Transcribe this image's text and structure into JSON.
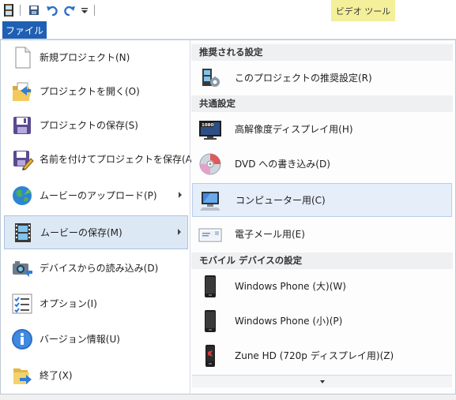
{
  "titlebar": {
    "context_tab": "ビデオ ツール",
    "icons": [
      "app-icon",
      "save-icon",
      "undo-icon",
      "redo-icon",
      "customize-dropdown-icon"
    ]
  },
  "ribbon": {
    "file_tab": "ファイル"
  },
  "file_menu": {
    "items": [
      {
        "label": "新規プロジェクト(N)",
        "icon": "new-document-icon"
      },
      {
        "label": "プロジェクトを開く(O)",
        "icon": "open-folder-icon"
      },
      {
        "label": "プロジェクトの保存(S)",
        "icon": "floppy-save-icon"
      },
      {
        "label": "名前を付けてプロジェクトを保存(A)",
        "icon": "save-as-icon"
      },
      {
        "label": "ムービーのアップロード(P)",
        "icon": "globe-upload-icon",
        "submenu": true
      },
      {
        "label": "ムービーの保存(M)",
        "icon": "film-save-icon",
        "submenu": true,
        "active": true
      },
      {
        "label": "デバイスからの読み込み(D)",
        "icon": "camera-import-icon"
      },
      {
        "label": "オプション(I)",
        "icon": "options-list-icon"
      },
      {
        "label": "バージョン情報(U)",
        "icon": "info-icon"
      },
      {
        "label": "終了(X)",
        "icon": "exit-icon"
      }
    ]
  },
  "save_movie_submenu": {
    "sections": [
      {
        "header": "推奨される設定",
        "items": [
          {
            "label": "このプロジェクトの推奨設定(R)",
            "icon": "recommended-settings-icon"
          }
        ]
      },
      {
        "header": "共通設定",
        "items": [
          {
            "label": "高解像度ディスプレイ用(H)",
            "icon": "hd-display-icon",
            "badge": "1080"
          },
          {
            "label": "DVD への書き込み(D)",
            "icon": "dvd-icon"
          },
          {
            "label": "コンピューター用(C)",
            "icon": "computer-icon",
            "hover": true
          },
          {
            "label": "電子メール用(E)",
            "icon": "email-icon"
          }
        ]
      },
      {
        "header": "モバイル デバイスの設定",
        "items": [
          {
            "label": "Windows Phone (大)(W)",
            "icon": "windows-phone-large-icon"
          },
          {
            "label": "Windows Phone (小)(P)",
            "icon": "windows-phone-small-icon"
          },
          {
            "label": "Zune HD (720p ディスプレイ用)(Z)",
            "icon": "zune-hd-icon"
          }
        ]
      }
    ],
    "scroll_icon": "scroll-down-icon"
  }
}
